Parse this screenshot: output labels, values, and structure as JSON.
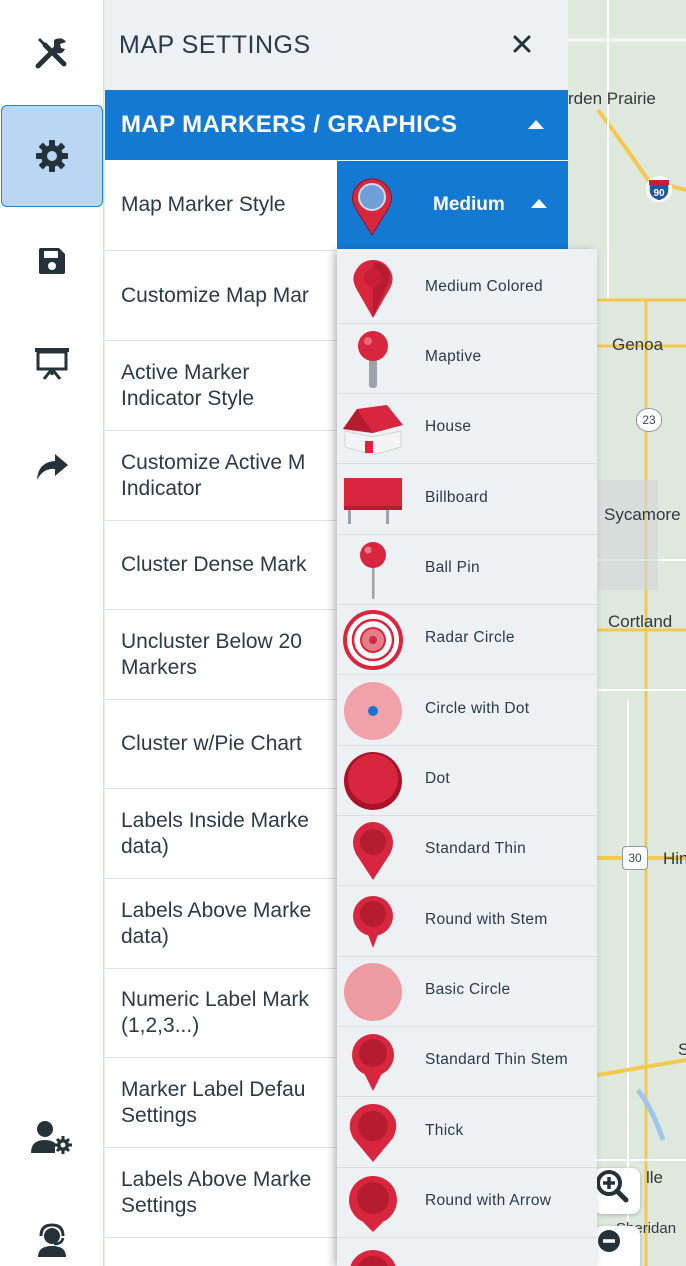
{
  "map": {
    "labels": [
      "rden Prairie",
      "Genoa",
      "Sycamore",
      "Cortland",
      "Hin",
      "lle",
      "Sheridan",
      "S"
    ],
    "shields": [
      "90",
      "23",
      "30"
    ]
  },
  "rail": {
    "items": [
      {
        "icon": "tools-icon",
        "active": false
      },
      {
        "icon": "gear-icon",
        "active": true
      },
      {
        "icon": "save-icon",
        "active": false
      },
      {
        "icon": "presentation-icon",
        "active": false
      },
      {
        "icon": "share-icon",
        "active": false
      },
      {
        "icon": "user-settings-icon",
        "active": false
      },
      {
        "icon": "support-agent-icon",
        "active": false
      }
    ]
  },
  "panel": {
    "title": "MAP SETTINGS",
    "section_title": "MAP MARKERS / GRAPHICS",
    "rows": [
      {
        "label": "Map Marker Style"
      },
      {
        "label": "Customize Map Mar"
      },
      {
        "label": "Active Marker\nIndicator Style"
      },
      {
        "label": "Customize Active M\nIndicator"
      },
      {
        "label": "Cluster Dense Mark"
      },
      {
        "label": "Uncluster Below 20\nMarkers"
      },
      {
        "label": "Cluster w/Pie Chart"
      },
      {
        "label": "Labels Inside Marke\ndata)"
      },
      {
        "label": "Labels Above Marke\ndata)"
      },
      {
        "label": "Numeric Label Mark\n(1,2,3...)"
      },
      {
        "label": "Marker Label Defau\nSettings"
      },
      {
        "label": "Labels Above Marke\nSettings"
      }
    ]
  },
  "marker_select": {
    "value": "Medium"
  },
  "dropdown": {
    "options": [
      {
        "label": "Medium Colored"
      },
      {
        "label": "Maptive"
      },
      {
        "label": "House"
      },
      {
        "label": "Billboard"
      },
      {
        "label": "Ball Pin"
      },
      {
        "label": "Radar Circle"
      },
      {
        "label": "Circle with Dot"
      },
      {
        "label": "Dot"
      },
      {
        "label": "Standard Thin"
      },
      {
        "label": "Round with Stem"
      },
      {
        "label": "Basic Circle"
      },
      {
        "label": "Standard Thin Stem"
      },
      {
        "label": "Thick"
      },
      {
        "label": "Round with Arrow"
      }
    ]
  },
  "colors": {
    "accent_blue": "#1479d2",
    "marker_red": "#d7263d",
    "panel_bg": "#eef1f4"
  }
}
